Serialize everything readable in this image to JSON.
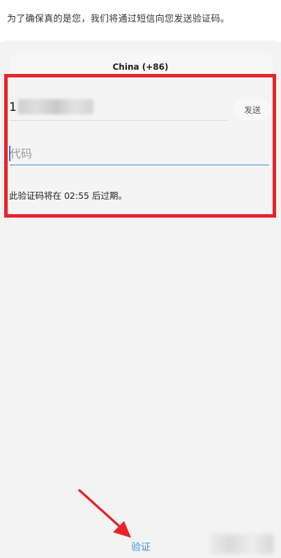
{
  "notice_text": "为了确保真的是您，我们将通过短信向您发送验证码。",
  "country": {
    "label": "China (+86)"
  },
  "phone": {
    "value": "1"
  },
  "send_button_label": "发送",
  "code_input": {
    "value": "",
    "placeholder": "代码"
  },
  "expiry_text": "此验证码将在 02:55 后过期。",
  "verify_button_label": "验证",
  "colors": {
    "accent": "#4a90e2",
    "annotation": "#e8232a"
  }
}
